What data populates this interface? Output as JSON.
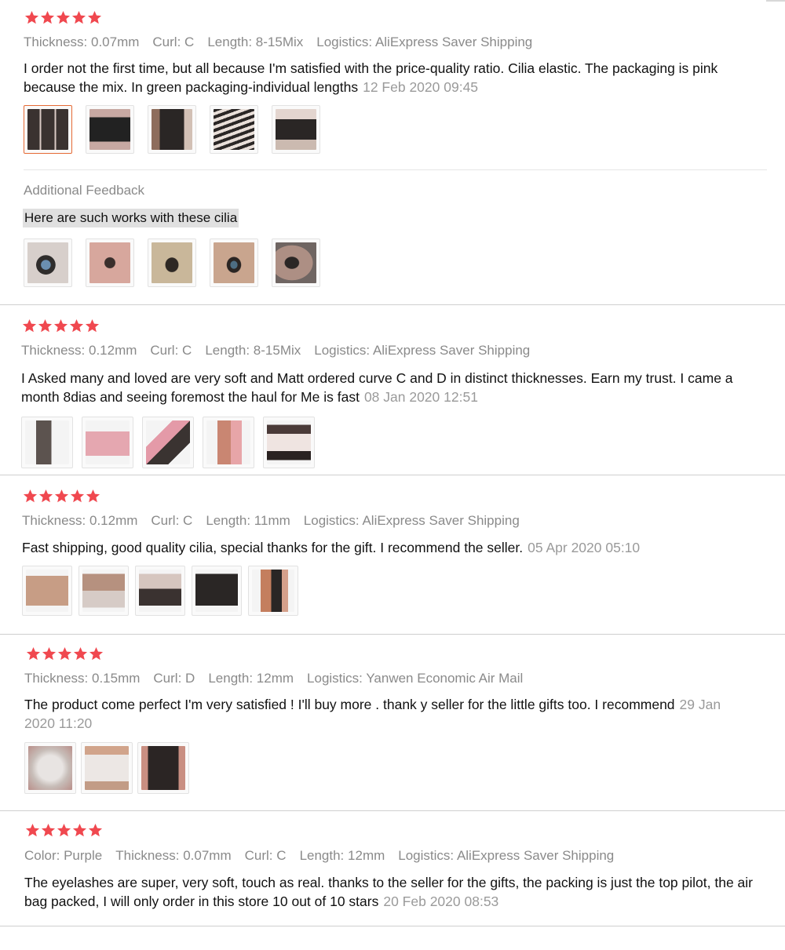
{
  "reviews": [
    {
      "stars": 5,
      "attributes": [
        {
          "label": "Thickness:",
          "value": "0.07mm"
        },
        {
          "label": "Curl:",
          "value": "C"
        },
        {
          "label": "Length:",
          "value": "8-15Mix"
        },
        {
          "label": "Logistics:",
          "value": "AliExpress Saver Shipping"
        }
      ],
      "text": "I order not the first time, but all because I'm satisfied with the price-quality ratio. Cilia elastic. The packaging is pink because the mix. In green packaging-individual lengths",
      "date": "12 Feb 2020 09:45",
      "thumbnails": [
        "product-photo-1",
        "product-photo-2",
        "product-photo-3",
        "product-photo-4",
        "product-photo-5"
      ],
      "additional": {
        "title": "Additional Feedback",
        "text": "Here are such works with these cilia",
        "thumbnails": [
          "eye-photo-1",
          "eye-photo-2",
          "eye-photo-3",
          "eye-photo-4",
          "eye-photo-5"
        ]
      }
    },
    {
      "stars": 5,
      "attributes": [
        {
          "label": "Thickness:",
          "value": "0.12mm"
        },
        {
          "label": "Curl:",
          "value": "C"
        },
        {
          "label": "Length:",
          "value": "8-15Mix"
        },
        {
          "label": "Logistics:",
          "value": "AliExpress Saver Shipping"
        }
      ],
      "text": "I Asked many and loved are very soft and Matt ordered curve C and D in distinct thicknesses. Earn my trust. I came a month 8dias and seeing foremost the haul for Me is fast",
      "date": "08 Jan 2020 12:51",
      "thumbnails": [
        "product-photo-1",
        "product-photo-2",
        "product-photo-3",
        "product-photo-4",
        "product-photo-5"
      ]
    },
    {
      "stars": 5,
      "attributes": [
        {
          "label": "Thickness:",
          "value": "0.12mm"
        },
        {
          "label": "Curl:",
          "value": "C"
        },
        {
          "label": "Length:",
          "value": "11mm"
        },
        {
          "label": "Logistics:",
          "value": "AliExpress Saver Shipping"
        }
      ],
      "text": "Fast shipping, good quality cilia, special thanks for the gift. I recommend the seller.",
      "date": "05 Apr 2020 05:10",
      "thumbnails": [
        "product-photo-1",
        "product-photo-2",
        "product-photo-3",
        "product-photo-4",
        "product-photo-5"
      ]
    },
    {
      "stars": 5,
      "attributes": [
        {
          "label": "Thickness:",
          "value": "0.15mm"
        },
        {
          "label": "Curl:",
          "value": "D"
        },
        {
          "label": "Length:",
          "value": "12mm"
        },
        {
          "label": "Logistics:",
          "value": "Yanwen Economic Air Mail"
        }
      ],
      "text": "The product come perfect I'm very satisfied ! I'll buy more . thank y seller for the little gifts too. I recommend",
      "date": "29 Jan 2020 11:20",
      "thumbnails": [
        "product-photo-1",
        "product-photo-2",
        "product-photo-3"
      ]
    },
    {
      "stars": 5,
      "attributes": [
        {
          "label": "Color:",
          "value": "Purple"
        },
        {
          "label": "Thickness:",
          "value": "0.07mm"
        },
        {
          "label": "Curl:",
          "value": "C"
        },
        {
          "label": "Length:",
          "value": "12mm"
        },
        {
          "label": "Logistics:",
          "value": "AliExpress Saver Shipping"
        }
      ],
      "text": "The eyelashes are super, very soft, touch as real. thanks to the seller for the gifts, the packing is just the top pilot, the air bag packed, I will only order in this store 10 out of 10 stars",
      "date": "20 Feb 2020 08:53",
      "thumbnails": []
    }
  ],
  "colors": {
    "star": "#f0484f",
    "muted_text": "#8a8a8a",
    "selected_thumb_border": "#e56a35"
  },
  "icons": {
    "star": "star-icon"
  }
}
